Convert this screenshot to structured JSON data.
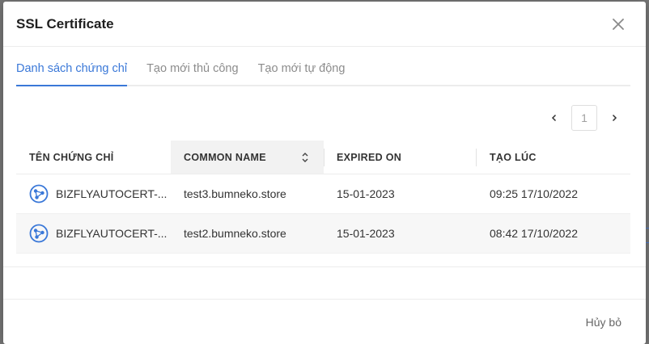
{
  "modal": {
    "title": "SSL Certificate",
    "tabs": [
      {
        "label": "Danh sách chứng chỉ",
        "active": true
      },
      {
        "label": "Tạo mới thủ công",
        "active": false
      },
      {
        "label": "Tạo mới tự động",
        "active": false
      }
    ],
    "pagination": {
      "current_page": "1"
    },
    "table": {
      "headers": [
        "TÊN CHỨNG CHỈ",
        "COMMON NAME",
        "EXPIRED ON",
        "TẠO LÚC"
      ],
      "rows": [
        {
          "name": "BIZFLYAUTOCERT-...",
          "common_name": "test3.bumneko.store",
          "expired_on": "15-01-2023",
          "created_at": "09:25 17/10/2022"
        },
        {
          "name": "BIZFLYAUTOCERT-...",
          "common_name": "test2.bumneko.store",
          "expired_on": "15-01-2023",
          "created_at": "08:42 17/10/2022"
        }
      ]
    },
    "footer": {
      "cancel_label": "Hủy bỏ"
    }
  },
  "colors": {
    "accent": "#3a78d8",
    "icon": "#3a78d8"
  }
}
